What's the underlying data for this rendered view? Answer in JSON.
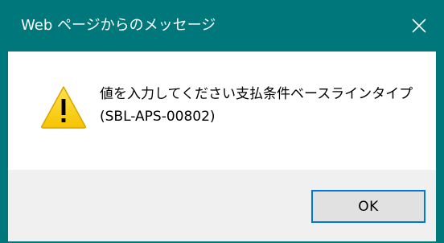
{
  "titlebar": {
    "title": "Web ページからのメッセージ",
    "close_icon": "close-icon",
    "color": "#00777a"
  },
  "dialog": {
    "icon": "warning-icon",
    "message_line1": "値を入力してください支払条件ベースラインタイプ",
    "message_line2": "(SBL-APS-00802)"
  },
  "buttons": {
    "ok_label": "OK",
    "ok_border_color": "#0078d7"
  }
}
